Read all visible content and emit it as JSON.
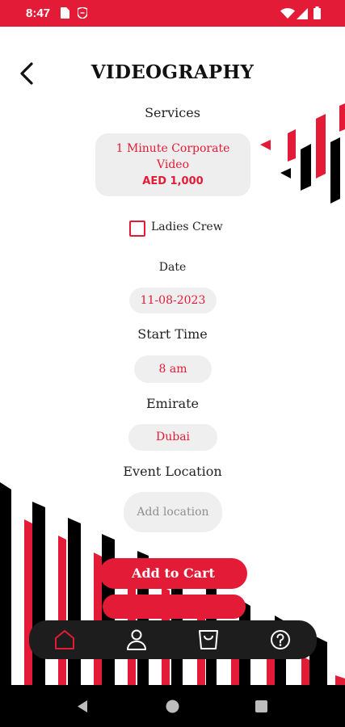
{
  "status_bar": {
    "time": "8:47",
    "color": "#e31b37"
  },
  "header": {
    "title": "VIDEOGRAPHY",
    "back_icon": "chevron-left-icon"
  },
  "services": {
    "label": "Services",
    "item_name": "1 Minute Corporate Video",
    "item_price": "AED 1,000"
  },
  "ladies_crew": {
    "label": "Ladies Crew",
    "checked": false
  },
  "date": {
    "label": "Date",
    "value": "11-08-2023"
  },
  "start_time": {
    "label": "Start Time",
    "value": "8 am"
  },
  "emirate": {
    "label": "Emirate",
    "value": "Dubai"
  },
  "event_location": {
    "label": "Event Location",
    "placeholder": "Add location",
    "value": ""
  },
  "actions": {
    "add_to_cart": "Add to Cart"
  },
  "bottom_nav": {
    "items": [
      {
        "name": "home",
        "icon": "home-icon",
        "active": true
      },
      {
        "name": "profile",
        "icon": "user-icon",
        "active": false
      },
      {
        "name": "cart",
        "icon": "shopping-bag-icon",
        "active": false
      },
      {
        "name": "help",
        "icon": "help-icon",
        "active": false
      }
    ]
  },
  "colors": {
    "accent": "#e31b37",
    "nav_bg": "#1d1d1d",
    "field_bg": "#efefef"
  }
}
